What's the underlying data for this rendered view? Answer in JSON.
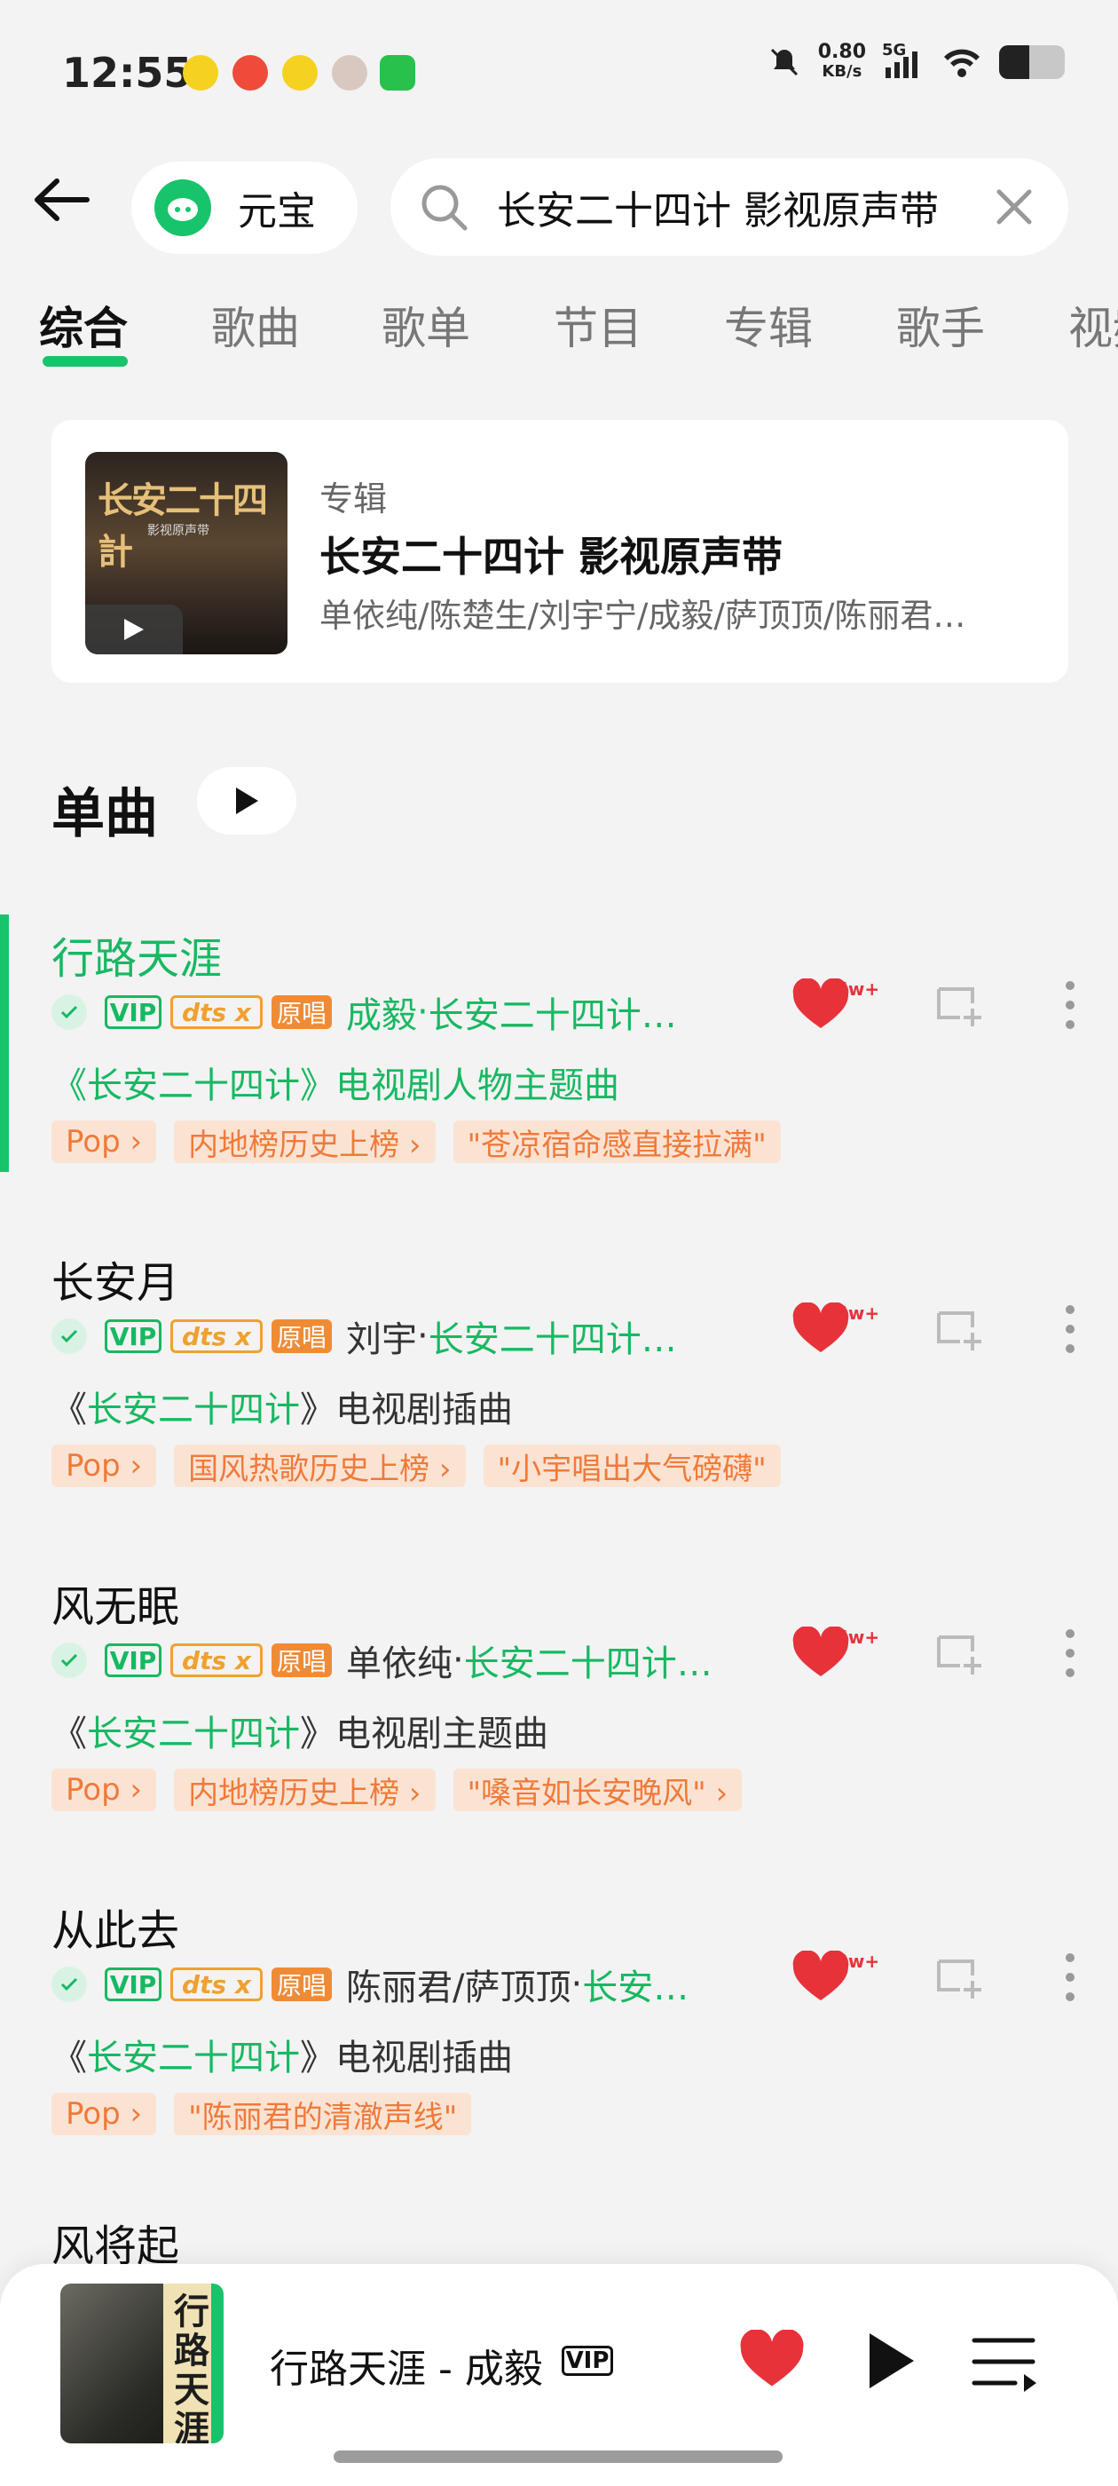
{
  "status_bar": {
    "time": "12:55",
    "net_speed_value": "0.80",
    "net_speed_unit": "KB/s",
    "network": "5G",
    "icons": [
      "qq-music-icon",
      "weibo-icon",
      "qq-music-icon",
      "avatar-icon",
      "wechat-icon",
      "mute-icon",
      "signal-icon",
      "wifi-icon",
      "battery-icon"
    ]
  },
  "header": {
    "assistant_label": "元宝",
    "search_value": "长安二十四计 影视原声带"
  },
  "tabs": [
    "综合",
    "歌曲",
    "歌单",
    "节目",
    "专辑",
    "歌手",
    "视频"
  ],
  "active_tab": "综合",
  "album_card": {
    "cover_text": "长安二十四計",
    "cover_subtext": "影视原声带",
    "type_label": "专辑",
    "title": "长安二十四计 影视原声带",
    "artists": "单依纯/陈楚生/刘宇宁/成毅/萨顶顶/陈丽君…"
  },
  "section": {
    "title": "单曲"
  },
  "badges": {
    "vip": "VIP",
    "dts": "dts x",
    "original": "原唱"
  },
  "songs": [
    {
      "title": "行路天涯",
      "artist": "成毅",
      "album": "长安二十四计…",
      "desc_pre": "《长安二十四计》电视剧人物主题曲",
      "desc_green": "",
      "desc_post": "",
      "like_count": "5w+",
      "tags": [
        "Pop ›",
        "内地榜历史上榜 ›",
        "\"苍凉宿命感直接拉满\""
      ]
    },
    {
      "title": "长安月",
      "artist": "刘宇",
      "album": "长安二十四计…",
      "desc_pre": "《",
      "desc_green": "长安二十四计",
      "desc_post": "》电视剧插曲",
      "like_count": "4w+",
      "tags": [
        "Pop ›",
        "国风热歌历史上榜 ›",
        "\"小宇唱出大气磅礴\""
      ]
    },
    {
      "title": "风无眠",
      "artist": "单依纯",
      "album": "长安二十四计…",
      "desc_pre": "《",
      "desc_green": "长安二十四计",
      "desc_post": "》电视剧主题曲",
      "like_count": "5w+",
      "tags": [
        "Pop ›",
        "内地榜历史上榜 ›",
        "\"嗓音如长安晚风\" ›"
      ]
    },
    {
      "title": "从此去",
      "artist": "陈丽君/萨顶顶",
      "album": "长安…",
      "desc_pre": "《",
      "desc_green": "长安二十四计",
      "desc_post": "》电视剧插曲",
      "like_count": "2w+",
      "tags": [
        "Pop ›",
        "\"陈丽君的清澈声线\""
      ]
    }
  ],
  "next_song_partial": "风将起",
  "mini_player": {
    "now_playing": "行路天涯 - 成毅",
    "vip_badge": "VIP",
    "cover_text": "行路天涯"
  },
  "colors": {
    "accent": "#17c46b",
    "accent_text": "#17b862",
    "heart": "#e8323a",
    "tag_bg": "#fbe3d3",
    "tag_text": "#f07a3a"
  }
}
